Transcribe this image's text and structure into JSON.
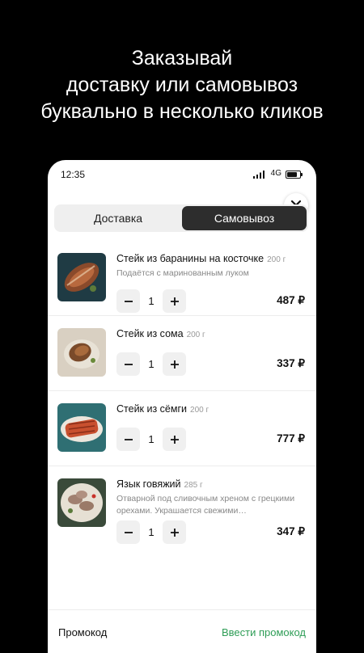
{
  "headline": {
    "line1": "Заказывай",
    "line2": "доставку или самовывоз",
    "line3": "буквально в несколько кликов"
  },
  "status_bar": {
    "time": "12:35",
    "network": "4G"
  },
  "tabs": [
    {
      "label": "Доставка",
      "selected": false
    },
    {
      "label": "Самовывоз",
      "selected": true
    }
  ],
  "items": [
    {
      "name": "Стейк из баранины на косточке",
      "weight": "200 г",
      "description": "Подаётся с маринованным луком",
      "quantity": "1",
      "price": "487 ₽"
    },
    {
      "name": "Стейк из сома",
      "weight": "200 г",
      "description": "",
      "quantity": "1",
      "price": "337 ₽"
    },
    {
      "name": "Стейк из сёмги",
      "weight": "200 г",
      "description": "",
      "quantity": "1",
      "price": "777 ₽"
    },
    {
      "name": "Язык говяжий",
      "weight": "285 г",
      "description": "Отварной под сливочным хреном с грецкими орехами. Украшается свежими…",
      "quantity": "1",
      "price": "347 ₽"
    }
  ],
  "footer": {
    "promo_label": "Промокод",
    "promo_link": "Ввести промокод"
  },
  "colors": {
    "accent_green": "#2e9d56",
    "tab_selected_bg": "#2d2d2d",
    "background": "#000000"
  },
  "icons": {
    "close": "close-icon",
    "minus": "minus-icon",
    "plus": "plus-icon",
    "battery": "battery-icon",
    "signal": "signal-icon"
  }
}
